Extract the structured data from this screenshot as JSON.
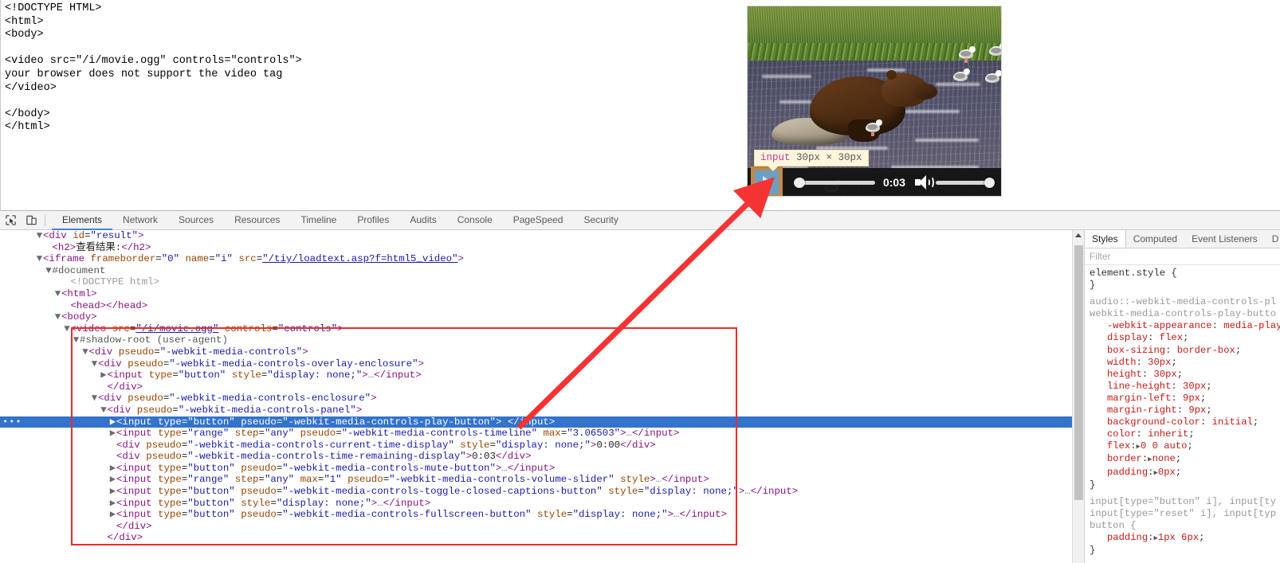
{
  "page_source": {
    "lines": [
      "<!DOCTYPE HTML>",
      "<html>",
      "<body>",
      "",
      "<video src=\"/i/movie.ogg\" controls=\"controls\">",
      "your browser does not support the video tag",
      "</video>",
      "",
      "</body>",
      "</html>"
    ]
  },
  "video_player": {
    "current_time_label": "0:03",
    "play_button_name": "play",
    "mute_button_name": "mute",
    "timeline_name": "timeline",
    "volume_name": "volume"
  },
  "element_tooltip": {
    "tag": "input",
    "dimensions": "30px × 30px"
  },
  "devtools": {
    "toolbar": {
      "inspect_icon": "inspect-cursor-icon",
      "device_icon": "device-toolbar-icon",
      "tabs": [
        {
          "label": "Elements",
          "active": true
        },
        {
          "label": "Network",
          "active": false
        },
        {
          "label": "Sources",
          "active": false
        },
        {
          "label": "Resources",
          "active": false
        },
        {
          "label": "Timeline",
          "active": false
        },
        {
          "label": "Profiles",
          "active": false
        },
        {
          "label": "Audits",
          "active": false
        },
        {
          "label": "Console",
          "active": false
        },
        {
          "label": "PageSpeed",
          "active": false
        },
        {
          "label": "Security",
          "active": false
        }
      ]
    },
    "dom_tree": [
      {
        "indent": 2,
        "caret": "▼",
        "html": "<span class=\"t\">&lt;div</span> <span class=\"a\">id</span>=<span class=\"v\">\"result\"</span><span class=\"t\">&gt;</span>"
      },
      {
        "indent": 3,
        "caret": "",
        "html": "<span class=\"t\">&lt;h2&gt;</span><span class=\"txt\">查看结果:</span><span class=\"t\">&lt;/h2&gt;</span>"
      },
      {
        "indent": 2,
        "caret": "▼",
        "html": "<span class=\"t\">&lt;iframe</span> <span class=\"a\">frameborder</span>=<span class=\"v\">\"0\"</span> <span class=\"a\">name</span>=<span class=\"v\">\"i\"</span> <span class=\"a\">src</span>=<span class=\"link\">\"/tiy/loadtext.asp?f=html5_video\"</span><span class=\"t\">&gt;</span>"
      },
      {
        "indent": 3,
        "caret": "▼",
        "html": "<span class=\"shadow\">#document</span>"
      },
      {
        "indent": 5,
        "caret": "",
        "html": "<span class=\"grey\">&lt;!DOCTYPE html&gt;</span>"
      },
      {
        "indent": 4,
        "caret": "▼",
        "html": "<span class=\"t\">&lt;html&gt;</span>"
      },
      {
        "indent": 5,
        "caret": "",
        "html": "<span class=\"t\">&lt;head&gt;&lt;/head&gt;</span>"
      },
      {
        "indent": 4,
        "caret": "▼",
        "html": "<span class=\"t\">&lt;body&gt;</span>"
      },
      {
        "indent": 5,
        "caret": "▼",
        "html": "<span class=\"t\">&lt;video</span> <span class=\"a\">src</span>=<span class=\"link\">\"/i/movie.ogg\"</span> <span class=\"a\">controls</span>=<span class=\"v\">\"controls\"</span><span class=\"t\">&gt;</span>"
      },
      {
        "indent": 6,
        "caret": "▼",
        "html": "<span class=\"shadow\">#shadow-root (user-agent)</span>"
      },
      {
        "indent": 7,
        "caret": "▼",
        "html": "<span class=\"t\">&lt;div</span> <span class=\"a\">pseudo</span>=<span class=\"v\">\"-webkit-media-controls\"</span><span class=\"t\">&gt;</span>"
      },
      {
        "indent": 8,
        "caret": "▼",
        "html": "<span class=\"t\">&lt;div</span> <span class=\"a\">pseudo</span>=<span class=\"v\">\"-webkit-media-controls-overlay-enclosure\"</span><span class=\"t\">&gt;</span>"
      },
      {
        "indent": 9,
        "caret": "▶",
        "html": "<span class=\"t\">&lt;input</span> <span class=\"a\">type</span>=<span class=\"v\">\"button\"</span> <span class=\"a\">style</span>=<span class=\"v\">\"display: none;\"</span><span class=\"t\">&gt;</span><span class=\"dots\">…</span><span class=\"t\">&lt;/input&gt;</span>"
      },
      {
        "indent": 9,
        "caret": "",
        "html": "<span class=\"t\">&lt;/div&gt;</span>"
      },
      {
        "indent": 8,
        "caret": "▼",
        "html": "<span class=\"t\">&lt;div</span> <span class=\"a\">pseudo</span>=<span class=\"v\">\"-webkit-media-controls-enclosure\"</span><span class=\"t\">&gt;</span>"
      },
      {
        "indent": 9,
        "caret": "▼",
        "html": "<span class=\"t\">&lt;div</span> <span class=\"a\">pseudo</span>=<span class=\"v\">\"-webkit-media-controls-panel\"</span><span class=\"t\">&gt;</span>"
      },
      {
        "indent": 10,
        "caret": "▶",
        "selected": true,
        "html": "<span class=\"t\">&lt;input</span> <span class=\"a\">type</span>=<span class=\"v\">\"button\"</span> <span class=\"a\">pseudo</span>=<span class=\"v\">\"-webkit-media-controls-play-button\"</span><span class=\"t\">&gt;</span><span class=\"dots\">…</span><span class=\"t\">&lt;/input&gt;</span>"
      },
      {
        "indent": 10,
        "caret": "▶",
        "html": "<span class=\"t\">&lt;input</span> <span class=\"a\">type</span>=<span class=\"v\">\"range\"</span> <span class=\"a\">step</span>=<span class=\"v\">\"any\"</span> <span class=\"a\">pseudo</span>=<span class=\"v\">\"-webkit-media-controls-timeline\"</span> <span class=\"a\">max</span>=<span class=\"v\">\"3.06503\"</span><span class=\"t\">&gt;</span><span class=\"dots\">…</span><span class=\"t\">&lt;/input&gt;</span>"
      },
      {
        "indent": 10,
        "caret": "",
        "html": "<span class=\"t\">&lt;div</span> <span class=\"a\">pseudo</span>=<span class=\"v\">\"-webkit-media-controls-current-time-display\"</span> <span class=\"a\">style</span>=<span class=\"v\">\"display: none;\"</span><span class=\"t\">&gt;</span><span class=\"txt\">0:00</span><span class=\"t\">&lt;/div&gt;</span>"
      },
      {
        "indent": 10,
        "caret": "",
        "html": "<span class=\"t\">&lt;div</span> <span class=\"a\">pseudo</span>=<span class=\"v\">\"-webkit-media-controls-time-remaining-display\"</span><span class=\"t\">&gt;</span><span class=\"txt\">0:03</span><span class=\"t\">&lt;/div&gt;</span>"
      },
      {
        "indent": 10,
        "caret": "▶",
        "html": "<span class=\"t\">&lt;input</span> <span class=\"a\">type</span>=<span class=\"v\">\"button\"</span> <span class=\"a\">pseudo</span>=<span class=\"v\">\"-webkit-media-controls-mute-button\"</span><span class=\"t\">&gt;</span><span class=\"dots\">…</span><span class=\"t\">&lt;/input&gt;</span>"
      },
      {
        "indent": 10,
        "caret": "▶",
        "html": "<span class=\"t\">&lt;input</span> <span class=\"a\">type</span>=<span class=\"v\">\"range\"</span> <span class=\"a\">step</span>=<span class=\"v\">\"any\"</span> <span class=\"a\">max</span>=<span class=\"v\">\"1\"</span> <span class=\"a\">pseudo</span>=<span class=\"v\">\"-webkit-media-controls-volume-slider\"</span> <span class=\"a\">style</span><span class=\"t\">&gt;</span><span class=\"dots\">…</span><span class=\"t\">&lt;/input&gt;</span>"
      },
      {
        "indent": 10,
        "caret": "▶",
        "html": "<span class=\"t\">&lt;input</span> <span class=\"a\">type</span>=<span class=\"v\">\"button\"</span> <span class=\"a\">pseudo</span>=<span class=\"v\">\"-webkit-media-controls-toggle-closed-captions-button\"</span> <span class=\"a\">style</span>=<span class=\"v\">\"display: none;\"</span><span class=\"t\">&gt;</span><span class=\"dots\">…</span><span class=\"t\">&lt;/input&gt;</span>"
      },
      {
        "indent": 10,
        "caret": "▶",
        "html": "<span class=\"t\">&lt;input</span> <span class=\"a\">type</span>=<span class=\"v\">\"button\"</span> <span class=\"a\">style</span>=<span class=\"v\">\"display: none;\"</span><span class=\"t\">&gt;</span><span class=\"dots\">…</span><span class=\"t\">&lt;/input&gt;</span>"
      },
      {
        "indent": 10,
        "caret": "▶",
        "html": "<span class=\"t\">&lt;input</span> <span class=\"a\">type</span>=<span class=\"v\">\"button\"</span> <span class=\"a\">pseudo</span>=<span class=\"v\">\"-webkit-media-controls-fullscreen-button\"</span> <span class=\"a\">style</span>=<span class=\"v\">\"display: none;\"</span><span class=\"t\">&gt;</span><span class=\"dots\">…</span><span class=\"t\">&lt;/input&gt;</span>"
      },
      {
        "indent": 10,
        "caret": "",
        "html": "<span class=\"t\">&lt;/div&gt;</span>"
      },
      {
        "indent": 9,
        "caret": "",
        "html": "<span class=\"t\">&lt;/div&gt;</span>"
      }
    ],
    "styles": {
      "tabs": [
        {
          "label": "Styles",
          "active": true
        },
        {
          "label": "Computed",
          "active": false
        },
        {
          "label": "Event Listeners",
          "active": false
        },
        {
          "label": "D",
          "active": false
        }
      ],
      "filter_placeholder": "Filter",
      "blocks": [
        {
          "kind": "rule",
          "selector": "element.style {",
          "decls": [],
          "close": "}"
        },
        {
          "kind": "ua",
          "selector_lines": [
            "audio::-webkit-media-controls-pl",
            "webkit-media-controls-play-butto"
          ],
          "decls": [
            {
              "prop": "-webkit-appearance",
              "value": "media-play"
            },
            {
              "prop": "display",
              "value": "flex"
            },
            {
              "prop": "box-sizing",
              "value": "border-box"
            },
            {
              "prop": "width",
              "value": "30px"
            },
            {
              "prop": "height",
              "value": "30px"
            },
            {
              "prop": "line-height",
              "value": "30px"
            },
            {
              "prop": "margin-left",
              "value": "9px"
            },
            {
              "prop": "margin-right",
              "value": "9px"
            },
            {
              "prop": "background-color",
              "value": "initial"
            },
            {
              "prop": "color",
              "value": "inherit"
            },
            {
              "prop": "flex",
              "value": "0 0 auto",
              "expandable": true
            },
            {
              "prop": "border",
              "value": "none",
              "expandable": true
            },
            {
              "prop": "padding",
              "value": "0px",
              "expandable": true
            }
          ],
          "close": "}"
        },
        {
          "kind": "ua",
          "selector_lines": [
            "input[type=\"button\" i], input[ty",
            "input[type=\"reset\" i], input[typ",
            "button {"
          ],
          "decls": [
            {
              "prop": "padding",
              "value": "1px 6px",
              "expandable": true
            }
          ],
          "close": "}"
        }
      ]
    }
  },
  "annotation": {
    "rect_color": "#ef2b2b",
    "arrow_color": "#f43333"
  }
}
